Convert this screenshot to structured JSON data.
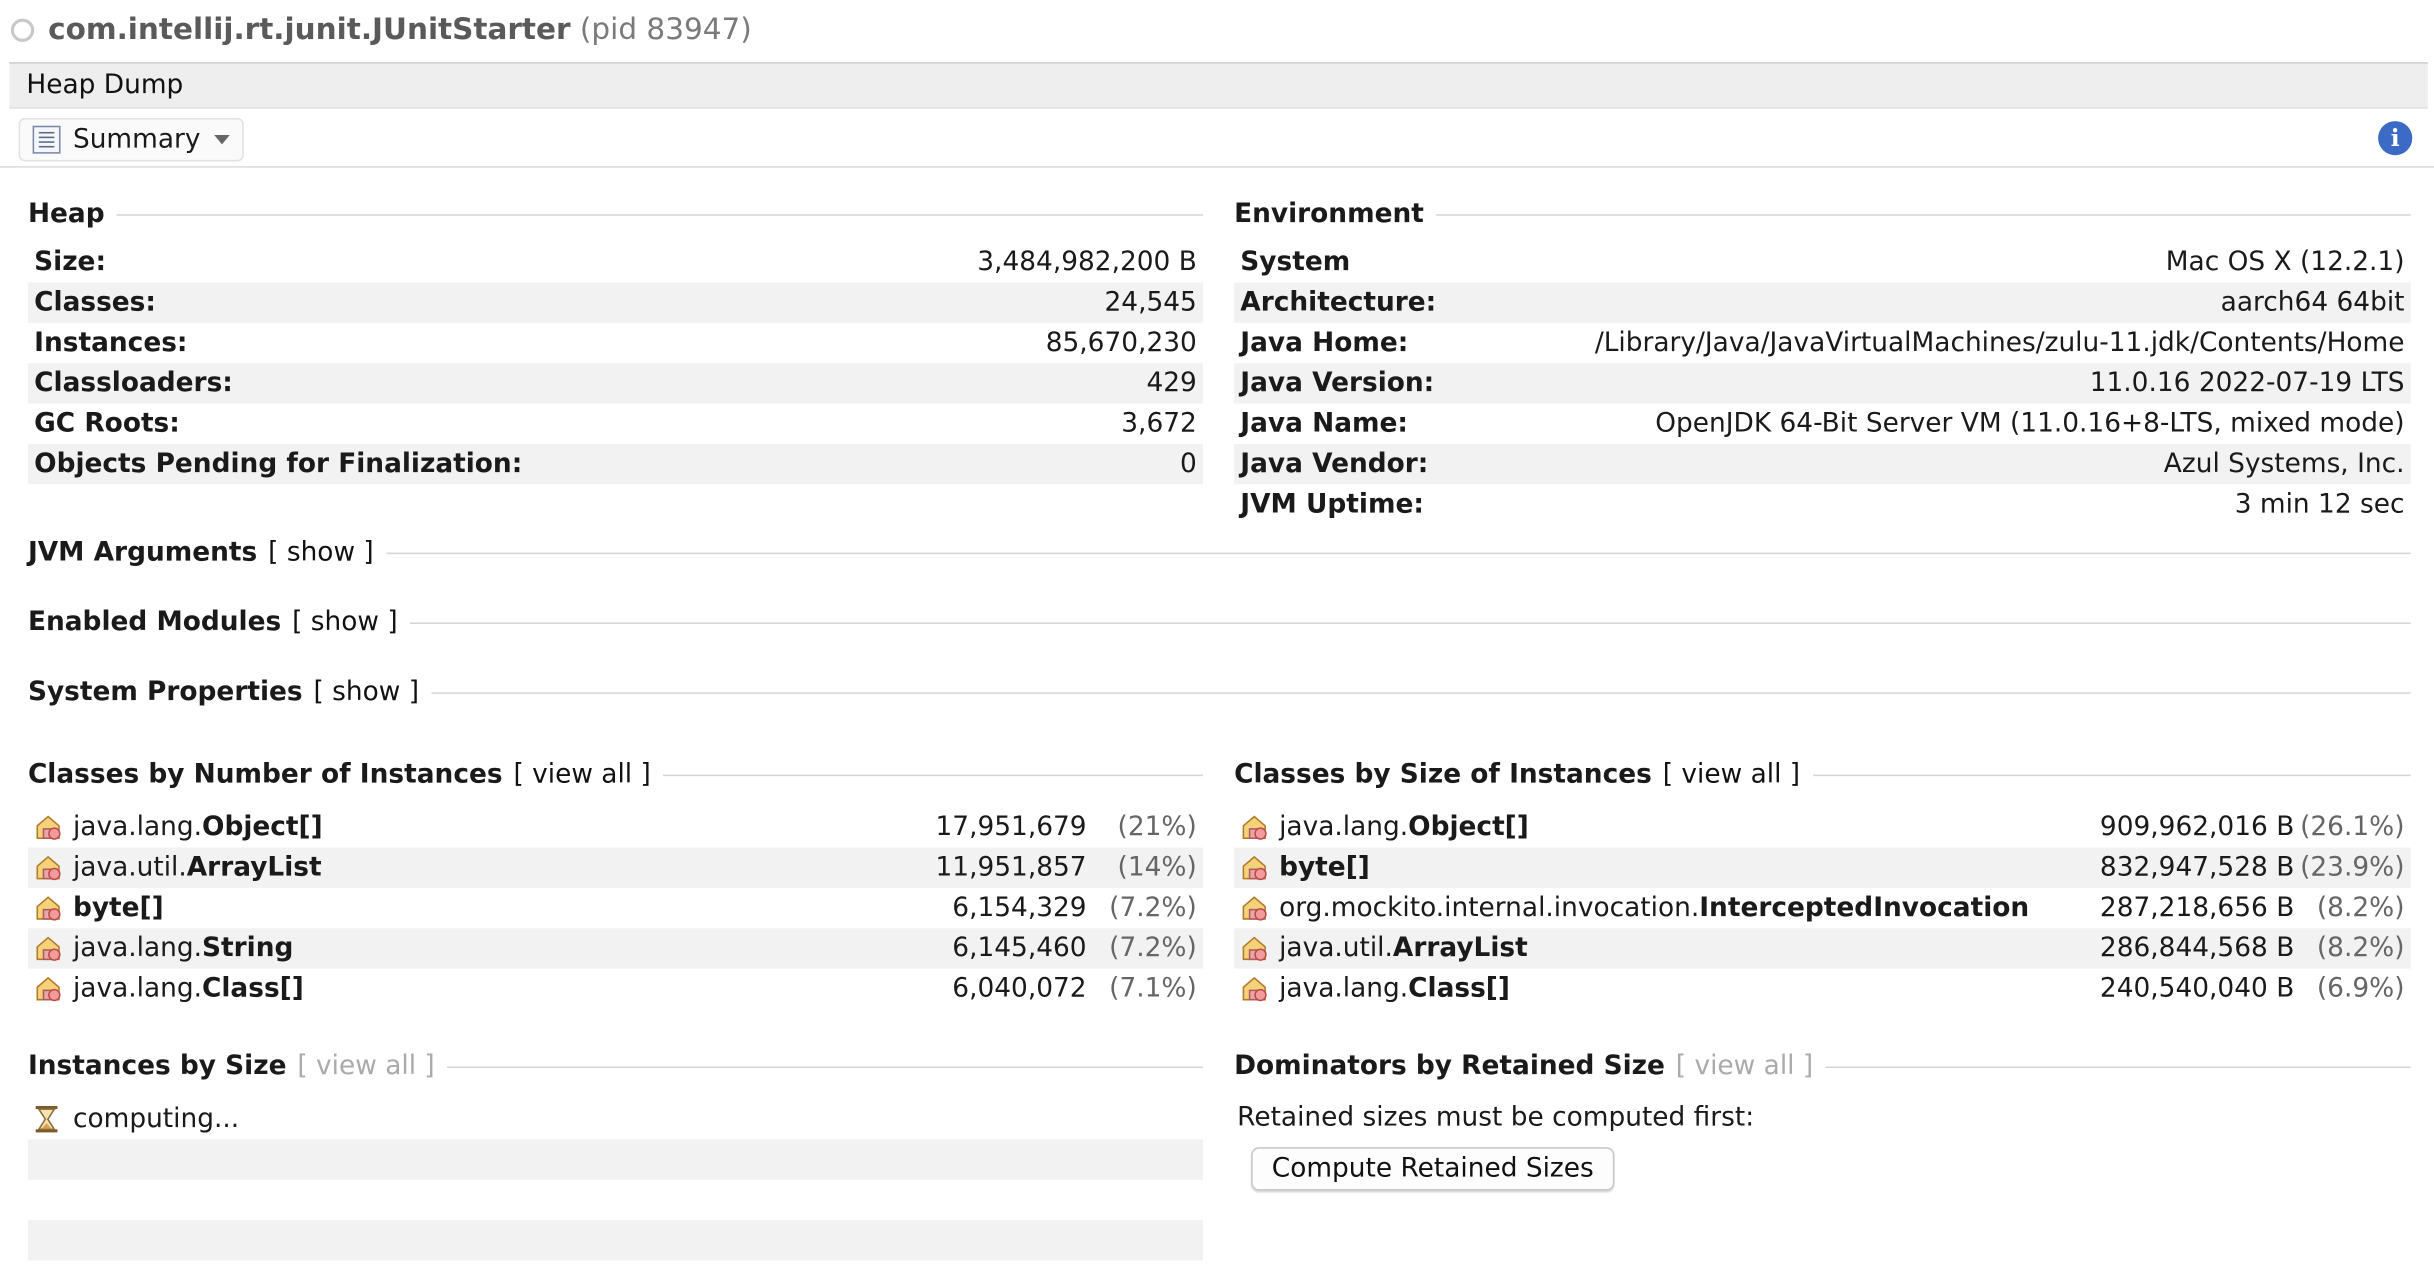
{
  "window": {
    "title": "com.intellij.rt.junit.JUnitStarter",
    "pid": "(pid 83947)"
  },
  "tab": {
    "label": "Heap Dump"
  },
  "toolbar": {
    "view_label": "Summary",
    "view_icon": "summary-icon",
    "info_icon": "info-icon"
  },
  "heap": {
    "title": "Heap",
    "rows": [
      {
        "label": "Size:",
        "value": "3,484,982,200 B"
      },
      {
        "label": "Classes:",
        "value": "24,545"
      },
      {
        "label": "Instances:",
        "value": "85,670,230"
      },
      {
        "label": "Classloaders:",
        "value": "429"
      },
      {
        "label": "GC Roots:",
        "value": "3,672"
      },
      {
        "label": "Objects Pending for Finalization:",
        "value": "0"
      }
    ]
  },
  "environment": {
    "title": "Environment",
    "rows": [
      {
        "label": "System",
        "value": "Mac OS X (12.2.1)"
      },
      {
        "label": "Architecture:",
        "value": "aarch64 64bit"
      },
      {
        "label": "Java Home:",
        "value": "/Library/Java/JavaVirtualMachines/zulu-11.jdk/Contents/Home"
      },
      {
        "label": "Java Version:",
        "value": "11.0.16 2022-07-19 LTS"
      },
      {
        "label": "Java Name:",
        "value": "OpenJDK 64-Bit Server VM (11.0.16+8-LTS, mixed mode)"
      },
      {
        "label": "Java Vendor:",
        "value": "Azul Systems, Inc."
      },
      {
        "label": "JVM Uptime:",
        "value": "3 min 12 sec"
      }
    ]
  },
  "sections": {
    "jvm_arguments": {
      "title": "JVM Arguments",
      "link": "[ show ]"
    },
    "enabled_modules": {
      "title": "Enabled Modules",
      "link": "[ show ]"
    },
    "system_properties": {
      "title": "System Properties",
      "link": "[ show ]"
    }
  },
  "classes_by_number": {
    "title": "Classes by Number of Instances",
    "link": "[ view all ]",
    "rows": [
      {
        "prefix": "java.lang.",
        "name": "Object[]",
        "value": "17,951,679",
        "pct": "(21%)"
      },
      {
        "prefix": "java.util.",
        "name": "ArrayList",
        "value": "11,951,857",
        "pct": "(14%)"
      },
      {
        "prefix": "",
        "name": "byte[]",
        "value": "6,154,329",
        "pct": "(7.2%)"
      },
      {
        "prefix": "java.lang.",
        "name": "String",
        "value": "6,145,460",
        "pct": "(7.2%)"
      },
      {
        "prefix": "java.lang.",
        "name": "Class[]",
        "value": "6,040,072",
        "pct": "(7.1%)"
      }
    ]
  },
  "classes_by_size": {
    "title": "Classes by Size of Instances",
    "link": "[ view all ]",
    "rows": [
      {
        "prefix": "java.lang.",
        "name": "Object[]",
        "value": "909,962,016 B",
        "pct": "(26.1%)"
      },
      {
        "prefix": "",
        "name": "byte[]",
        "value": "832,947,528 B",
        "pct": "(23.9%)"
      },
      {
        "prefix": "org.mockito.internal.invocation.",
        "name": "InterceptedInvocation",
        "value": "287,218,656 B",
        "pct": "(8.2%)"
      },
      {
        "prefix": "java.util.",
        "name": "ArrayList",
        "value": "286,844,568 B",
        "pct": "(8.2%)"
      },
      {
        "prefix": "java.lang.",
        "name": "Class[]",
        "value": "240,540,040 B",
        "pct": "(6.9%)"
      }
    ]
  },
  "instances_by_size": {
    "title": "Instances by Size",
    "link": "[ view all ]",
    "status": "computing..."
  },
  "dominators": {
    "title": "Dominators by Retained Size",
    "link": "[ view all ]",
    "message": "Retained sizes must be computed first:",
    "button_label": "Compute Retained Sizes"
  }
}
